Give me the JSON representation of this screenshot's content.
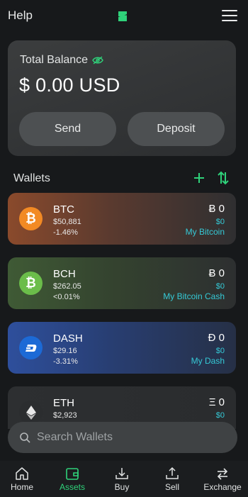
{
  "header": {
    "help_label": "Help"
  },
  "balance": {
    "label": "Total Balance",
    "value": "$ 0.00 USD",
    "send_label": "Send",
    "deposit_label": "Deposit"
  },
  "wallets_section": {
    "title": "Wallets"
  },
  "wallets": [
    {
      "symbol": "BTC",
      "price": "$50,881",
      "change": "-1.46%",
      "amount": "Ƀ 0",
      "usd": "$0",
      "name": "My Bitcoin",
      "icon": "bitcoin-icon",
      "color": "#f28a24"
    },
    {
      "symbol": "BCH",
      "price": "$262.05",
      "change": "<0.01%",
      "amount": "Ƀ 0",
      "usd": "$0",
      "name": "My Bitcoin Cash",
      "icon": "bitcoin-cash-icon",
      "color": "#6bbd4a"
    },
    {
      "symbol": "DASH",
      "price": "$29.16",
      "change": "-3.31%",
      "amount": "Đ 0",
      "usd": "$0",
      "name": "My Dash",
      "icon": "dash-icon",
      "color": "#1c6ad6"
    },
    {
      "symbol": "ETH",
      "price": "$2,923",
      "amount": "Ξ 0",
      "usd": "$0",
      "icon": "ethereum-icon",
      "color": "#2b2d2f"
    }
  ],
  "search": {
    "placeholder": "Search Wallets"
  },
  "nav": [
    {
      "label": "Home",
      "icon": "home-icon"
    },
    {
      "label": "Assets",
      "icon": "wallet-icon",
      "active": true
    },
    {
      "label": "Buy",
      "icon": "buy-icon"
    },
    {
      "label": "Sell",
      "icon": "sell-icon"
    },
    {
      "label": "Exchange",
      "icon": "exchange-icon"
    }
  ],
  "colors": {
    "accent": "#2fd27a",
    "link": "#35c9d6",
    "background": "#17191b"
  }
}
